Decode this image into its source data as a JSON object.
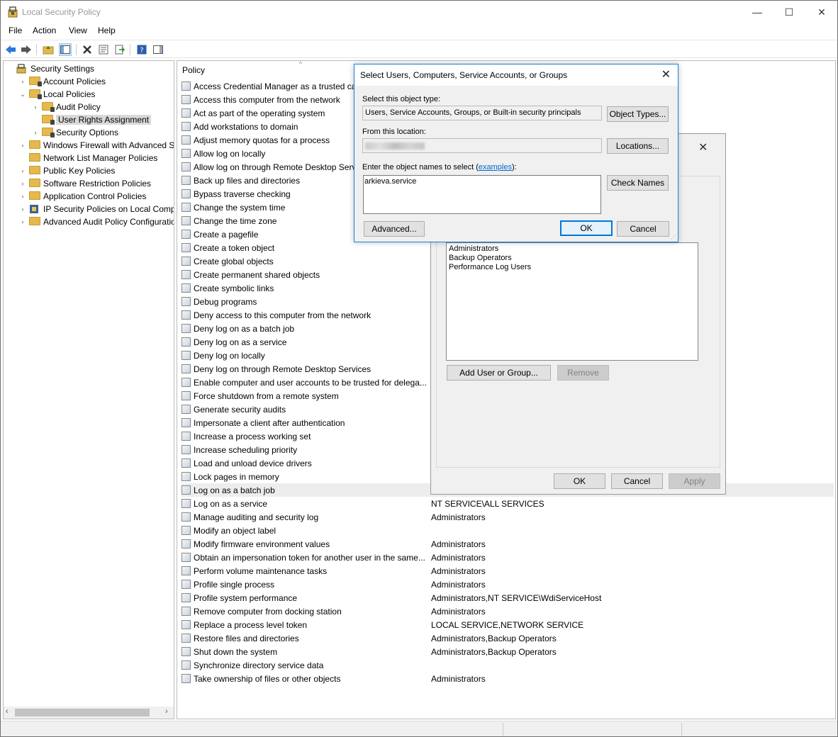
{
  "window": {
    "title": "Local Security Policy",
    "minimize": "—",
    "maximize": "☐",
    "close": "✕"
  },
  "menu": [
    "File",
    "Action",
    "View",
    "Help"
  ],
  "tree": [
    {
      "label": "Security Settings",
      "level": 0,
      "arrow": "",
      "icon": "security-settings-icon"
    },
    {
      "label": "Account Policies",
      "level": 1,
      "arrow": "›",
      "icon": "folder-icon"
    },
    {
      "label": "Local Policies",
      "level": 1,
      "arrow": "⌄",
      "icon": "folder-icon"
    },
    {
      "label": "Audit Policy",
      "level": 2,
      "arrow": "›",
      "icon": "folder-icon"
    },
    {
      "label": "User Rights Assignment",
      "level": 2,
      "arrow": "",
      "icon": "folder-icon",
      "selected": true
    },
    {
      "label": "Security Options",
      "level": 2,
      "arrow": "›",
      "icon": "folder-icon"
    },
    {
      "label": "Windows Firewall with Advanced Secu",
      "level": 1,
      "arrow": "›",
      "icon": "folder-icon"
    },
    {
      "label": "Network List Manager Policies",
      "level": 1,
      "arrow": "",
      "icon": "folder-icon"
    },
    {
      "label": "Public Key Policies",
      "level": 1,
      "arrow": "›",
      "icon": "folder-icon"
    },
    {
      "label": "Software Restriction Policies",
      "level": 1,
      "arrow": "›",
      "icon": "folder-icon"
    },
    {
      "label": "Application Control Policies",
      "level": 1,
      "arrow": "›",
      "icon": "folder-icon"
    },
    {
      "label": "IP Security Policies on Local Compute",
      "level": 1,
      "arrow": "›",
      "icon": "ipsec-icon"
    },
    {
      "label": "Advanced Audit Policy Configuration",
      "level": 1,
      "arrow": "›",
      "icon": "folder-icon"
    }
  ],
  "list": {
    "column_policy": "Policy",
    "rows": [
      {
        "policy": "Access Credential Manager as a trusted caller",
        "setting": ""
      },
      {
        "policy": "Access this computer from the network",
        "setting": ""
      },
      {
        "policy": "Act as part of the operating system",
        "setting": ""
      },
      {
        "policy": "Add workstations to domain",
        "setting": ""
      },
      {
        "policy": "Adjust memory quotas for a process",
        "setting": ""
      },
      {
        "policy": "Allow log on locally",
        "setting": ""
      },
      {
        "policy": "Allow log on through Remote Desktop Services",
        "setting": ""
      },
      {
        "policy": "Back up files and directories",
        "setting": ""
      },
      {
        "policy": "Bypass traverse checking",
        "setting": ""
      },
      {
        "policy": "Change the system time",
        "setting": ""
      },
      {
        "policy": "Change the time zone",
        "setting": ""
      },
      {
        "policy": "Create a pagefile",
        "setting": ""
      },
      {
        "policy": "Create a token object",
        "setting": ""
      },
      {
        "policy": "Create global objects",
        "setting": ""
      },
      {
        "policy": "Create permanent shared objects",
        "setting": ""
      },
      {
        "policy": "Create symbolic links",
        "setting": ""
      },
      {
        "policy": "Debug programs",
        "setting": ""
      },
      {
        "policy": "Deny access to this computer from the network",
        "setting": ""
      },
      {
        "policy": "Deny log on as a batch job",
        "setting": ""
      },
      {
        "policy": "Deny log on as a service",
        "setting": ""
      },
      {
        "policy": "Deny log on locally",
        "setting": ""
      },
      {
        "policy": "Deny log on through Remote Desktop Services",
        "setting": ""
      },
      {
        "policy": "Enable computer and user accounts to be trusted for delega...",
        "setting": ""
      },
      {
        "policy": "Force shutdown from a remote system",
        "setting": ""
      },
      {
        "policy": "Generate security audits",
        "setting": ""
      },
      {
        "policy": "Impersonate a client after authentication",
        "setting": ""
      },
      {
        "policy": "Increase a process working set",
        "setting": ""
      },
      {
        "policy": "Increase scheduling priority",
        "setting": ""
      },
      {
        "policy": "Load and unload device drivers",
        "setting": ""
      },
      {
        "policy": "Lock pages in memory",
        "setting": ""
      },
      {
        "policy": "Log on as a batch job",
        "setting": "",
        "highlight": true
      },
      {
        "policy": "Log on as a service",
        "setting": "NT SERVICE\\ALL SERVICES"
      },
      {
        "policy": "Manage auditing and security log",
        "setting": "Administrators"
      },
      {
        "policy": "Modify an object label",
        "setting": ""
      },
      {
        "policy": "Modify firmware environment values",
        "setting": "Administrators"
      },
      {
        "policy": "Obtain an impersonation token for another user in the same...",
        "setting": "Administrators"
      },
      {
        "policy": "Perform volume maintenance tasks",
        "setting": "Administrators"
      },
      {
        "policy": "Profile single process",
        "setting": "Administrators"
      },
      {
        "policy": "Profile system performance",
        "setting": "Administrators,NT SERVICE\\WdiServiceHost"
      },
      {
        "policy": "Remove computer from docking station",
        "setting": "Administrators"
      },
      {
        "policy": "Replace a process level token",
        "setting": "LOCAL SERVICE,NETWORK SERVICE"
      },
      {
        "policy": "Restore files and directories",
        "setting": "Administrators,Backup Operators"
      },
      {
        "policy": "Shut down the system",
        "setting": "Administrators,Backup Operators"
      },
      {
        "policy": "Synchronize directory service data",
        "setting": ""
      },
      {
        "policy": "Take ownership of files or other objects",
        "setting": "Administrators"
      }
    ]
  },
  "props_dialog": {
    "close": "✕",
    "members": [
      "Administrators",
      "Backup Operators",
      "Performance Log Users"
    ],
    "add_button": "Add User or Group...",
    "remove_button": "Remove",
    "ok": "OK",
    "cancel": "Cancel",
    "apply": "Apply"
  },
  "select_dialog": {
    "title": "Select Users, Computers, Service Accounts, or Groups",
    "close": "✕",
    "object_type_label": "Select this object type:",
    "object_type_value": "Users, Service Accounts, Groups, or Built-in security principals",
    "object_types_button": "Object Types...",
    "location_label": "From this location:",
    "locations_button": "Locations...",
    "names_label": "Enter the object names to select",
    "names_label_open": "(",
    "examples_link": "examples",
    "names_label_close": "):",
    "names_value": "arkieva.service",
    "check_names_button": "Check Names",
    "advanced_button": "Advanced...",
    "ok": "OK",
    "cancel": "Cancel"
  }
}
